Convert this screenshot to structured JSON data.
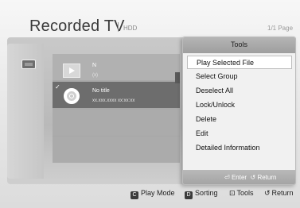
{
  "header": {
    "title": "Recorded TV",
    "source": "HDD",
    "page_indicator": "1/1 Page"
  },
  "list": {
    "items": [
      {
        "title": "N",
        "meta": "(x)",
        "checked": false
      },
      {
        "title": "No title",
        "meta": "xx.xxx.xxxx  xx:xx:xx",
        "checked": true
      }
    ]
  },
  "tools_menu": {
    "title": "Tools",
    "items": [
      {
        "label": "Play Selected File",
        "selected": true
      },
      {
        "label": "Select Group"
      },
      {
        "label": "Deselect All"
      },
      {
        "label": "Lock/Unlock"
      },
      {
        "label": "Delete"
      },
      {
        "label": "Edit"
      },
      {
        "label": "Detailed Information"
      }
    ],
    "footer": {
      "enter_label": "Enter",
      "return_label": "Return"
    }
  },
  "bottom_bar": {
    "c_key": "C",
    "play_mode": "Play Mode",
    "d_key": "D",
    "sorting": "Sorting",
    "tools": "Tools",
    "return": "Return"
  },
  "icons": [
    "tv-device-icon",
    "play-icon",
    "film-reel-icon",
    "checkmark-icon",
    "enter-icon",
    "return-icon",
    "tools-icon"
  ]
}
